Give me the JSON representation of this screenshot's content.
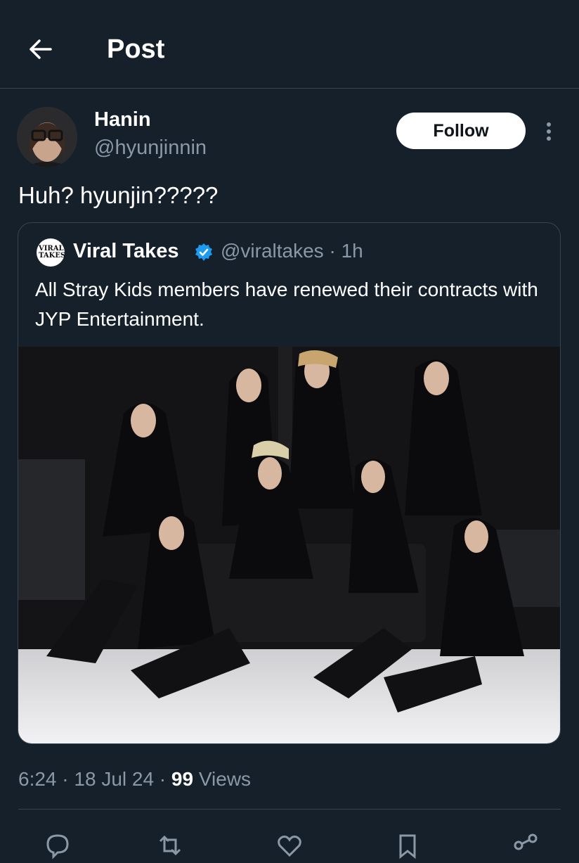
{
  "header": {
    "title": "Post",
    "back_icon": "arrow-left-icon"
  },
  "author": {
    "display_name": "Hanin",
    "handle": "@hyunjinnin",
    "follow_label": "Follow"
  },
  "tweet": {
    "text": "Huh? hyunjin?????"
  },
  "quote": {
    "avatar_text": "VIRAL TAKES",
    "name": "Viral Takes",
    "verified_icon": "verified-badge-icon",
    "handle_time": "@viraltakes · 1h",
    "text": "All Stray Kids members have renewed their contracts with JYP Entertainment."
  },
  "meta": {
    "time": "6:24",
    "sep1": " · ",
    "date": "18 Jul 24",
    "sep2": " · ",
    "views_count": "99",
    "views_label": " Views"
  },
  "actions": [
    "reply-icon",
    "repost-icon",
    "like-icon",
    "bookmark-icon",
    "share-icon"
  ],
  "colors": {
    "background": "#15202b",
    "border": "#38444d",
    "muted": "#8b98a5",
    "verified": "#1d9bf0"
  }
}
